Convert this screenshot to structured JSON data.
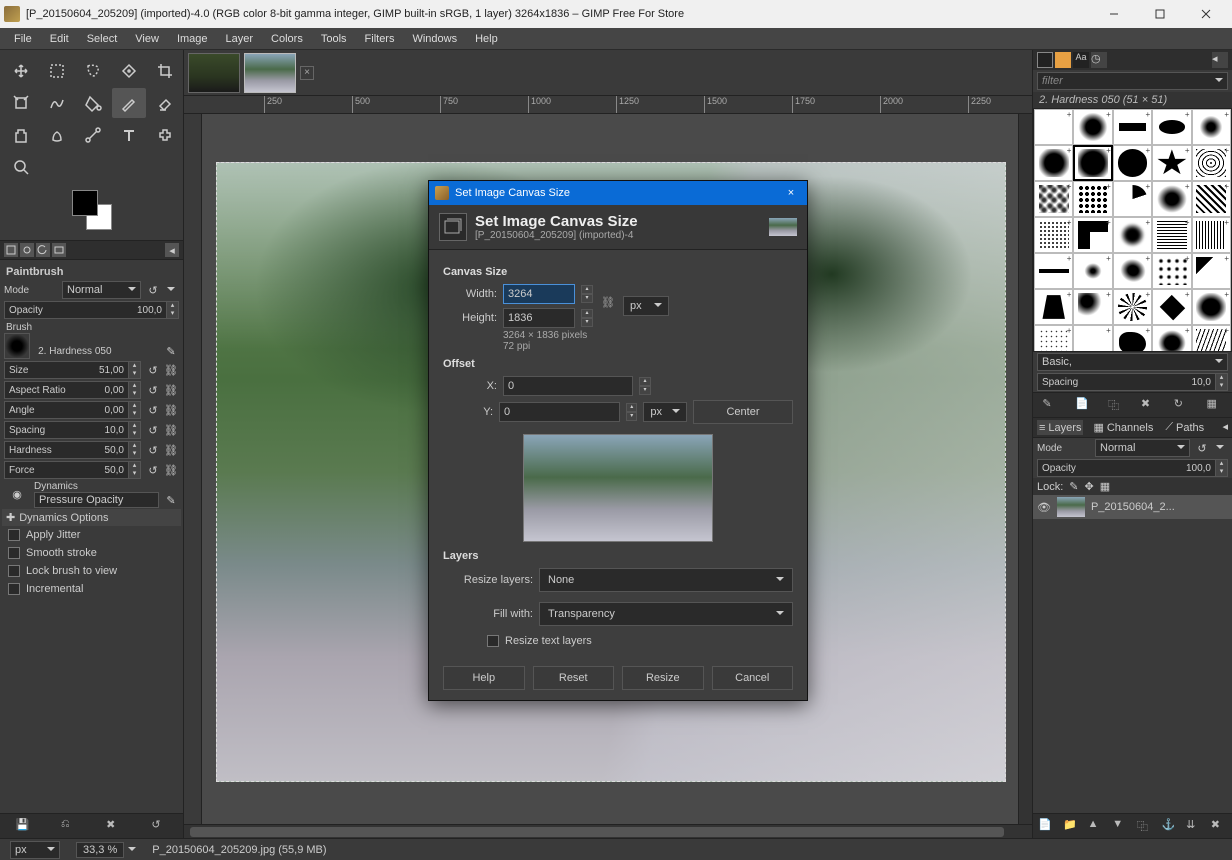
{
  "titlebar": {
    "text": "[P_20150604_205209] (imported)-4.0 (RGB color 8-bit gamma integer, GIMP built-in sRGB, 1 layer) 3264x1836 – GIMP Free For Store"
  },
  "menubar": [
    "File",
    "Edit",
    "Select",
    "View",
    "Image",
    "Layer",
    "Colors",
    "Tools",
    "Filters",
    "Windows",
    "Help"
  ],
  "tool_options": {
    "title": "Paintbrush",
    "mode_label": "Mode",
    "mode_value": "Normal",
    "opacity_label": "Opacity",
    "opacity_value": "100,0",
    "brush_section": "Brush",
    "brush_name": "2. Hardness 050",
    "size_label": "Size",
    "size_value": "51,00",
    "aspect_label": "Aspect Ratio",
    "aspect_value": "0,00",
    "angle_label": "Angle",
    "angle_value": "0,00",
    "spacing_label": "Spacing",
    "spacing_value": "10,0",
    "hardness_label": "Hardness",
    "hardness_value": "50,0",
    "force_label": "Force",
    "force_value": "50,0",
    "dynamics_section": "Dynamics",
    "dynamics_value": "Pressure Opacity",
    "dyn_options": "Dynamics Options",
    "apply_jitter": "Apply Jitter",
    "smooth_stroke": "Smooth stroke",
    "lock_brush": "Lock brush to view",
    "incremental": "Incremental"
  },
  "right": {
    "filter_placeholder": "filter",
    "brush_title": "2. Hardness 050 (51 × 51)",
    "basic": "Basic,",
    "spacing_label": "Spacing",
    "spacing_value": "10,0",
    "layers_tab": "Layers",
    "channels_tab": "Channels",
    "paths_tab": "Paths",
    "mode_label": "Mode",
    "mode_value": "Normal",
    "opacity_label": "Opacity",
    "opacity_value": "100,0",
    "lock_label": "Lock:",
    "layer_name": "P_20150604_2..."
  },
  "ruler_ticks": [
    "250",
    "500",
    "750",
    "1000",
    "1250",
    "1500",
    "1750",
    "2000",
    "2250"
  ],
  "statusbar": {
    "unit": "px",
    "zoom": "33,3 %",
    "filename": "P_20150604_205209.jpg (55,9 MB)"
  },
  "dialog": {
    "window_title": "Set Image Canvas Size",
    "heading": "Set Image Canvas Size",
    "subtitle": "[P_20150604_205209] (imported)-4",
    "canvas_size": "Canvas Size",
    "width_label": "Width:",
    "width_value": "3264",
    "height_label": "Height:",
    "height_value": "1836",
    "unit": "px",
    "info1": "3264 × 1836 pixels",
    "info2": "72 ppi",
    "offset": "Offset",
    "x_label": "X:",
    "x_value": "0",
    "y_label": "Y:",
    "y_value": "0",
    "center": "Center",
    "layers": "Layers",
    "resize_layers_label": "Resize layers:",
    "resize_layers_value": "None",
    "fill_label": "Fill with:",
    "fill_value": "Transparency",
    "resize_text": "Resize text layers",
    "help": "Help",
    "reset": "Reset",
    "resize": "Resize",
    "cancel": "Cancel"
  }
}
